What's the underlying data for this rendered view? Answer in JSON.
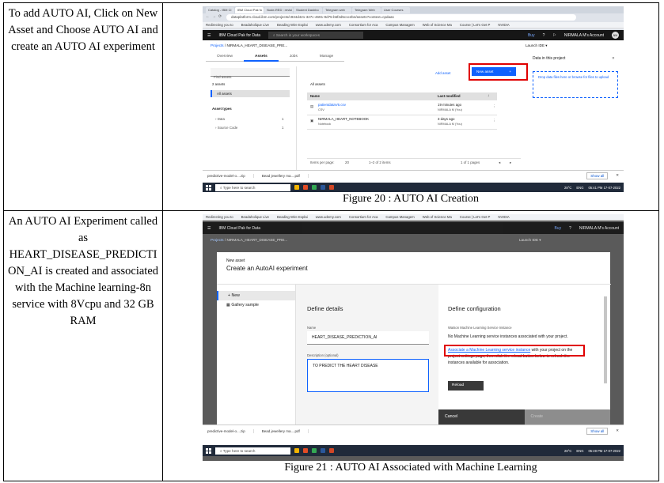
{
  "rows": [
    {
      "description": "To add AUTO AI, Click on New Asset and Choose AUTO AI and create an AUTO AI experiment",
      "caption": "Figure 20 : AUTO AI Creation",
      "screenshot": {
        "tabs": [
          "Catalog - IBM Cl",
          "IBM Cloud Pak fo",
          "Node-RED : revisi",
          "Student Dashbo",
          "Telegram web",
          "Telegram Web",
          "User Courses"
        ],
        "url": "dataplatform.cloud.ibm.com/projects/c934d421-327c-4691-9d75-b6f2d5c1c2b4/assets?context=cpdaas",
        "bookmarks": [
          "Redirecting you to",
          "Beadaholique Live",
          "Beading Wire Explai",
          "www.udemy.com",
          "Consortium for Aca",
          "Campus Managem",
          "Web of Science Ma",
          "Course | Let's Get P",
          "NVIDIA"
        ],
        "app_name": "IBM Cloud Pak for Data",
        "search_placeholder": "Search in your workspaces",
        "buy": "Buy",
        "account": "NIRMALA M's Account",
        "avatar": "NM",
        "breadcrumb_link": "Projects",
        "breadcrumb_current": "NIRMALA_HEART_DISEASE_PRE...",
        "launch_ide": "Launch IDE",
        "page_tabs": [
          "Overview",
          "Assets",
          "Jobs",
          "Manage"
        ],
        "active_tab": "Assets",
        "find_assets": "Find assets",
        "assets_count": "2 assets",
        "all_assets": "All assets",
        "asset_types": "Asset types",
        "asset_type_rows": [
          {
            "label": "Data",
            "count": "1"
          },
          {
            "label": "Source Code",
            "count": "1"
          }
        ],
        "add_asset": "Add asset",
        "new_asset": "New asset",
        "table_title": "All assets",
        "col_name": "Name",
        "col_modified": "Last modified",
        "table_rows": [
          {
            "name": "patientdataV6.csv",
            "type": "CSV",
            "time": "19 minutes ago",
            "who": "NIRMALA M (You)"
          },
          {
            "name": "NIRMALA_HEART_NOTEBOOK",
            "type": "Notebook",
            "time": "3 days ago",
            "who": "NIRMALA M (You)"
          }
        ],
        "items_per_page": "Items per page:",
        "items_per_page_value": "20",
        "items_range": "1–2 of 2 items",
        "pages": "1 of 1 pages",
        "side_title": "Data in this project",
        "drop_text": "Drop data files here or browse for files to upload",
        "downloads": [
          "predictive-model-o....zip",
          "Bead jewellery ma....pdf"
        ],
        "show_all": "Show all",
        "taskbar_search": "Type here to search",
        "weather": "28°C",
        "lang": "ENG",
        "time": "05:41 PM",
        "date": "17-07-2022"
      }
    },
    {
      "description": "An AUTO AI Experiment called as HEART_DISEASE_PREDICTION_AI is created and associated with the Machine learning-8n service with 8Vcpu and 32 GB RAM",
      "caption": "Figure 21 : AUTO AI Associated with Machine Learning",
      "screenshot": {
        "bookmarks": [
          "Redirecting you to",
          "Beadaholique Live",
          "Beading Wire Explai",
          "www.udemy.com",
          "Consortium for Aca",
          "Campus Managem",
          "Web of Science Ma",
          "Course | Let's Get P",
          "NVIDIA"
        ],
        "app_name": "IBM Cloud Pak for Data",
        "buy": "Buy",
        "account": "NIRMALA M's Account",
        "breadcrumb_link": "Projects",
        "breadcrumb_current": "NIRMALA_HEART_DISEASE_PRE...",
        "launch_ide": "Launch IDE",
        "modal_kicker": "New asset",
        "modal_title": "Create an AutoAI experiment",
        "nav_new": "New",
        "nav_gallery": "Gallery sample",
        "define_details": "Define details",
        "name_label": "Name",
        "name_value": "HEART_DISEASE_PREDICTION_AI",
        "desc_label": "Description (optional)",
        "desc_value": "TO PREDICT THE HEART DISEASE",
        "define_config": "Define configuration",
        "service_label": "Watson Machine Learning Service Instance",
        "no_service": "No Machine Learning service instances associated with your project.",
        "associate_link": "Associate a Machine Learning service instance",
        "associate_rest": "with your project on the project settings page, then click the reload button below to refresh the instances available for association.",
        "reload": "Reload",
        "cancel": "Cancel",
        "create": "Create",
        "status_url": "https://dataplatform.cloud.ibm.com/data/discovery/predictive-modeling/picker?target=ml&tab=new&close=true&projectId=c934d421-327c-4691-9d75-b6f2d5c1c2b4&context=cpdaas",
        "downloads": [
          "predictive-model-o....zip",
          "Bead jewellery ma....pdf"
        ],
        "show_all": "Show all",
        "taskbar_search": "Type here to search",
        "weather": "28°C",
        "lang": "ENG",
        "time": "05:49 PM",
        "date": "17-07-2022"
      }
    }
  ]
}
